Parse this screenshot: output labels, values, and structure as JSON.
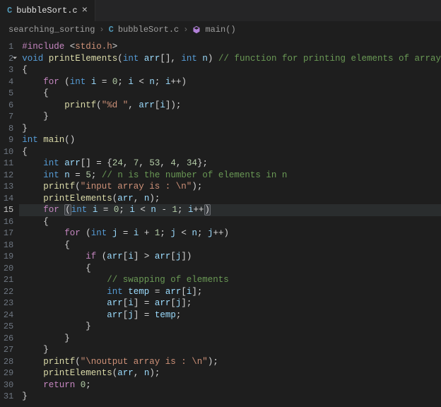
{
  "tab": {
    "icon_letter": "C",
    "filename": "bubbleSort.c",
    "close_glyph": "×"
  },
  "breadcrumb": {
    "folder": "searching_sorting",
    "file_icon_letter": "C",
    "file": "bubbleSort.c",
    "symbol": "main()",
    "sep": "›"
  },
  "active_line": 15,
  "lines": [
    {
      "n": 1,
      "indent": 0,
      "tokens": [
        [
          "kw2",
          "#include"
        ],
        [
          "op",
          " "
        ],
        [
          "op",
          "<"
        ],
        [
          "lib",
          "stdio.h"
        ],
        [
          "op",
          ">"
        ]
      ]
    },
    {
      "n": 2,
      "indent": 0,
      "fold": true,
      "tokens": [
        [
          "kw",
          "void"
        ],
        [
          "op",
          " "
        ],
        [
          "fn",
          "printElements"
        ],
        [
          "op",
          "("
        ],
        [
          "type",
          "int"
        ],
        [
          "op",
          " "
        ],
        [
          "var",
          "arr"
        ],
        [
          "op",
          "[], "
        ],
        [
          "type",
          "int"
        ],
        [
          "op",
          " "
        ],
        [
          "var",
          "n"
        ],
        [
          "op",
          ") "
        ],
        [
          "cmt",
          "// function for printing elements of array"
        ]
      ]
    },
    {
      "n": 3,
      "indent": 0,
      "tokens": [
        [
          "op",
          "{"
        ]
      ]
    },
    {
      "n": 4,
      "indent": 1,
      "tokens": [
        [
          "kw2",
          "for"
        ],
        [
          "op",
          " ("
        ],
        [
          "type",
          "int"
        ],
        [
          "op",
          " "
        ],
        [
          "var",
          "i"
        ],
        [
          "op",
          " = "
        ],
        [
          "num",
          "0"
        ],
        [
          "op",
          "; "
        ],
        [
          "var",
          "i"
        ],
        [
          "op",
          " < "
        ],
        [
          "var",
          "n"
        ],
        [
          "op",
          "; "
        ],
        [
          "var",
          "i"
        ],
        [
          "op",
          "++)"
        ]
      ]
    },
    {
      "n": 5,
      "indent": 1,
      "tokens": [
        [
          "op",
          "{"
        ]
      ]
    },
    {
      "n": 6,
      "indent": 2,
      "tokens": [
        [
          "fn",
          "printf"
        ],
        [
          "op",
          "("
        ],
        [
          "str",
          "\"%d \""
        ],
        [
          "op",
          ", "
        ],
        [
          "var",
          "arr"
        ],
        [
          "op",
          "["
        ],
        [
          "var",
          "i"
        ],
        [
          "op",
          "]);"
        ]
      ]
    },
    {
      "n": 7,
      "indent": 1,
      "tokens": [
        [
          "op",
          "}"
        ]
      ]
    },
    {
      "n": 8,
      "indent": 0,
      "tokens": [
        [
          "op",
          "}"
        ]
      ]
    },
    {
      "n": 9,
      "indent": 0,
      "tokens": [
        [
          "type",
          "int"
        ],
        [
          "op",
          " "
        ],
        [
          "fn",
          "main"
        ],
        [
          "op",
          "()"
        ]
      ]
    },
    {
      "n": 10,
      "indent": 0,
      "tokens": [
        [
          "op",
          "{"
        ]
      ]
    },
    {
      "n": 11,
      "indent": 1,
      "tokens": [
        [
          "type",
          "int"
        ],
        [
          "op",
          " "
        ],
        [
          "var",
          "arr"
        ],
        [
          "op",
          "[] = {"
        ],
        [
          "num",
          "24"
        ],
        [
          "op",
          ", "
        ],
        [
          "num",
          "7"
        ],
        [
          "op",
          ", "
        ],
        [
          "num",
          "53"
        ],
        [
          "op",
          ", "
        ],
        [
          "num",
          "4"
        ],
        [
          "op",
          ", "
        ],
        [
          "num",
          "34"
        ],
        [
          "op",
          "};"
        ]
      ]
    },
    {
      "n": 12,
      "indent": 1,
      "tokens": [
        [
          "type",
          "int"
        ],
        [
          "op",
          " "
        ],
        [
          "var",
          "n"
        ],
        [
          "op",
          " = "
        ],
        [
          "num",
          "5"
        ],
        [
          "op",
          "; "
        ],
        [
          "cmt",
          "// n is the number of elements in n"
        ]
      ]
    },
    {
      "n": 13,
      "indent": 1,
      "tokens": [
        [
          "fn",
          "printf"
        ],
        [
          "op",
          "("
        ],
        [
          "str",
          "\"input array is : \\n\""
        ],
        [
          "op",
          ");"
        ]
      ]
    },
    {
      "n": 14,
      "indent": 1,
      "tokens": [
        [
          "fn",
          "printElements"
        ],
        [
          "op",
          "("
        ],
        [
          "var",
          "arr"
        ],
        [
          "op",
          ", "
        ],
        [
          "var",
          "n"
        ],
        [
          "op",
          ");"
        ]
      ]
    },
    {
      "n": 15,
      "indent": 1,
      "active": true,
      "tokens": [
        [
          "kw2",
          "for"
        ],
        [
          "op",
          " "
        ],
        [
          "hl",
          "("
        ],
        [
          "type",
          "int"
        ],
        [
          "op",
          " "
        ],
        [
          "var",
          "i"
        ],
        [
          "op",
          " = "
        ],
        [
          "num",
          "0"
        ],
        [
          "op",
          "; "
        ],
        [
          "var",
          "i"
        ],
        [
          "op",
          " < "
        ],
        [
          "var",
          "n"
        ],
        [
          "op",
          " - "
        ],
        [
          "num",
          "1"
        ],
        [
          "op",
          "; "
        ],
        [
          "var",
          "i"
        ],
        [
          "op",
          "++"
        ],
        [
          "hl",
          ")"
        ]
      ]
    },
    {
      "n": 16,
      "indent": 1,
      "tokens": [
        [
          "op",
          "{"
        ]
      ]
    },
    {
      "n": 17,
      "indent": 2,
      "tokens": [
        [
          "kw2",
          "for"
        ],
        [
          "op",
          " ("
        ],
        [
          "type",
          "int"
        ],
        [
          "op",
          " "
        ],
        [
          "var",
          "j"
        ],
        [
          "op",
          " = "
        ],
        [
          "var",
          "i"
        ],
        [
          "op",
          " + "
        ],
        [
          "num",
          "1"
        ],
        [
          "op",
          "; "
        ],
        [
          "var",
          "j"
        ],
        [
          "op",
          " < "
        ],
        [
          "var",
          "n"
        ],
        [
          "op",
          "; "
        ],
        [
          "var",
          "j"
        ],
        [
          "op",
          "++)"
        ]
      ]
    },
    {
      "n": 18,
      "indent": 2,
      "tokens": [
        [
          "op",
          "{"
        ]
      ]
    },
    {
      "n": 19,
      "indent": 3,
      "tokens": [
        [
          "kw2",
          "if"
        ],
        [
          "op",
          " ("
        ],
        [
          "var",
          "arr"
        ],
        [
          "op",
          "["
        ],
        [
          "var",
          "i"
        ],
        [
          "op",
          "] > "
        ],
        [
          "var",
          "arr"
        ],
        [
          "op",
          "["
        ],
        [
          "var",
          "j"
        ],
        [
          "op",
          "])"
        ]
      ]
    },
    {
      "n": 20,
      "indent": 3,
      "tokens": [
        [
          "op",
          "{"
        ]
      ]
    },
    {
      "n": 21,
      "indent": 4,
      "tokens": [
        [
          "cmt",
          "// swapping of elements"
        ]
      ]
    },
    {
      "n": 22,
      "indent": 4,
      "tokens": [
        [
          "type",
          "int"
        ],
        [
          "op",
          " "
        ],
        [
          "var",
          "temp"
        ],
        [
          "op",
          " = "
        ],
        [
          "var",
          "arr"
        ],
        [
          "op",
          "["
        ],
        [
          "var",
          "i"
        ],
        [
          "op",
          "];"
        ]
      ]
    },
    {
      "n": 23,
      "indent": 4,
      "tokens": [
        [
          "var",
          "arr"
        ],
        [
          "op",
          "["
        ],
        [
          "var",
          "i"
        ],
        [
          "op",
          "] = "
        ],
        [
          "var",
          "arr"
        ],
        [
          "op",
          "["
        ],
        [
          "var",
          "j"
        ],
        [
          "op",
          "];"
        ]
      ]
    },
    {
      "n": 24,
      "indent": 4,
      "tokens": [
        [
          "var",
          "arr"
        ],
        [
          "op",
          "["
        ],
        [
          "var",
          "j"
        ],
        [
          "op",
          "] = "
        ],
        [
          "var",
          "temp"
        ],
        [
          "op",
          ";"
        ]
      ]
    },
    {
      "n": 25,
      "indent": 3,
      "tokens": [
        [
          "op",
          "}"
        ]
      ]
    },
    {
      "n": 26,
      "indent": 2,
      "tokens": [
        [
          "op",
          "}"
        ]
      ]
    },
    {
      "n": 27,
      "indent": 1,
      "tokens": [
        [
          "op",
          "}"
        ]
      ]
    },
    {
      "n": 28,
      "indent": 1,
      "tokens": [
        [
          "fn",
          "printf"
        ],
        [
          "op",
          "("
        ],
        [
          "str",
          "\"\\noutput array is : \\n\""
        ],
        [
          "op",
          ");"
        ]
      ]
    },
    {
      "n": 29,
      "indent": 1,
      "tokens": [
        [
          "fn",
          "printElements"
        ],
        [
          "op",
          "("
        ],
        [
          "var",
          "arr"
        ],
        [
          "op",
          ", "
        ],
        [
          "var",
          "n"
        ],
        [
          "op",
          ");"
        ]
      ]
    },
    {
      "n": 30,
      "indent": 1,
      "tokens": [
        [
          "kw2",
          "return"
        ],
        [
          "op",
          " "
        ],
        [
          "num",
          "0"
        ],
        [
          "op",
          ";"
        ]
      ]
    },
    {
      "n": 31,
      "indent": 0,
      "tokens": [
        [
          "op",
          "}"
        ]
      ]
    }
  ]
}
